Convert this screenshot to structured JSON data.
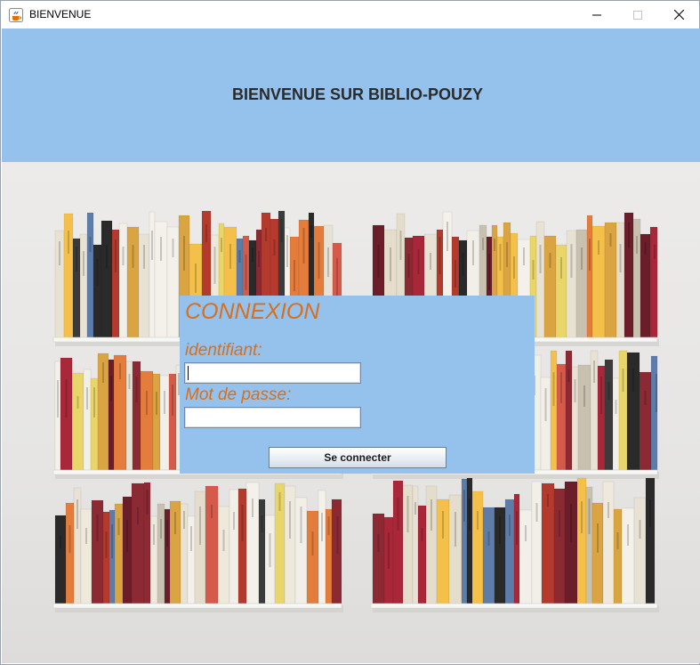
{
  "window": {
    "title": "BIENVENUE",
    "icon": "java-cup-icon"
  },
  "banner": {
    "title": "BIENVENUE SUR BIBLIO-POUZY",
    "bg_color": "#94c2ec"
  },
  "login": {
    "title": "CONNEXION",
    "id_label": "identifiant:",
    "id_value": "",
    "pw_label": "Mot de passe:",
    "pw_value": "",
    "button_label": "Se connecter",
    "accent_color": "#d96e1b",
    "bg_color": "#94c2ec"
  },
  "background": {
    "description_icon": "bookshelf-photo"
  }
}
